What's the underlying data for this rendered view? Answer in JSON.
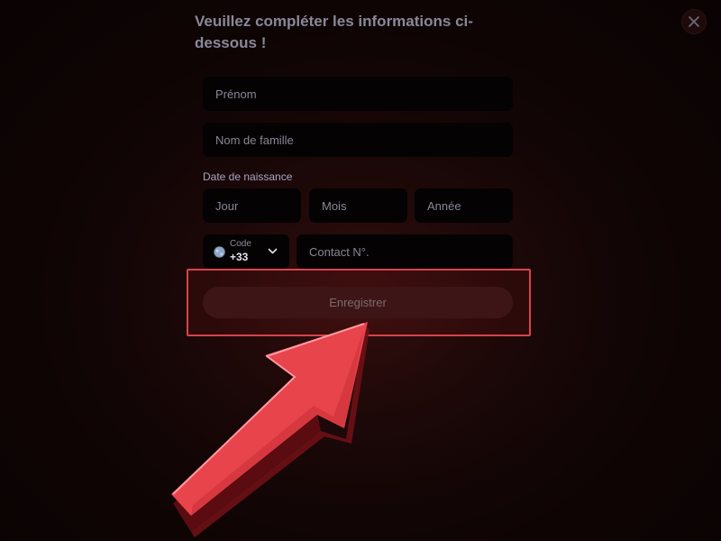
{
  "dialog": {
    "title": "Veuillez compléter les informations ci-dessous !"
  },
  "form": {
    "first_name_placeholder": "Prénom",
    "last_name_placeholder": "Nom de famille",
    "birth_date_label": "Date de naissance",
    "day_placeholder": "Jour",
    "month_placeholder": "Mois",
    "year_placeholder": "Année",
    "phone_code_label": "Code",
    "phone_code_value": "+33",
    "phone_placeholder": "Contact N°.",
    "submit_label": "Enregistrer"
  },
  "icons": {
    "close": "close-icon",
    "globe": "globe-icon",
    "chevron": "chevron-down-icon",
    "annotation_arrow": "arrow-annotation"
  },
  "colors": {
    "background": "#120505",
    "field_background": "#050203",
    "submit_background": "#3e1516",
    "highlight": "#d9434b",
    "arrow": "#e8444c"
  }
}
